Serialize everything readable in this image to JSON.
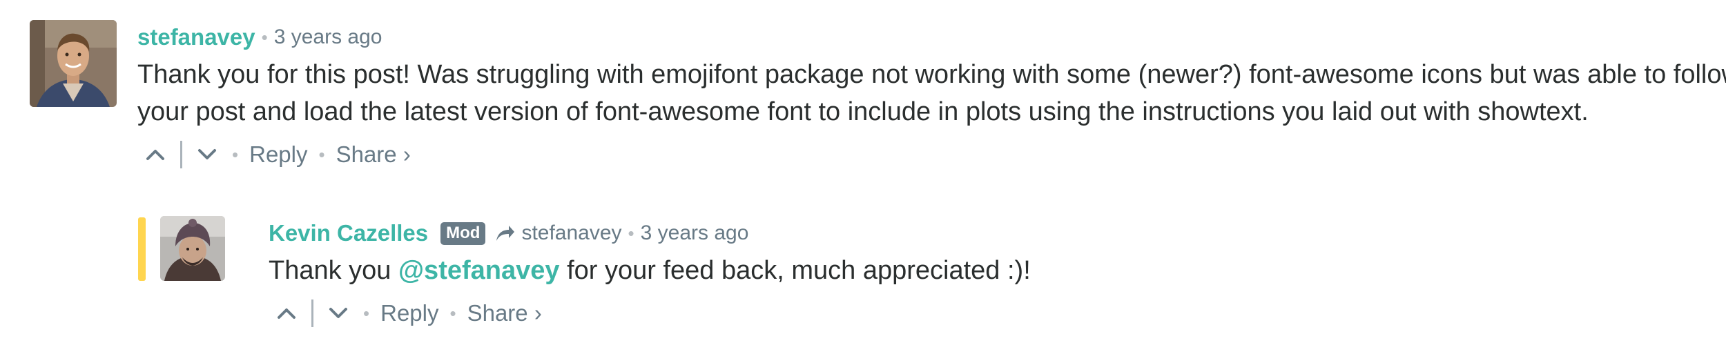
{
  "comments": [
    {
      "author": "stefanavey",
      "time": "3 years ago",
      "message": "Thank you for this post! Was struggling with emojifont package not working with some (newer?) font-awesome icons but was able to follow your post and load the latest version of font-awesome font to include in plots using the instructions you laid out with showtext.",
      "actions": {
        "reply": "Reply",
        "share": "Share ›"
      }
    },
    {
      "author": "Kevin Cazelles",
      "badge": "Mod",
      "in_reply_to": "stefanavey",
      "time": "3 years ago",
      "message_prefix": "Thank you ",
      "mention": "@stefanavey",
      "message_suffix": " for your feed back, much appreciated :)!",
      "actions": {
        "reply": "Reply",
        "share": "Share ›"
      }
    }
  ],
  "icons": {
    "upvote": "chevron-up-icon",
    "downvote": "chevron-down-icon",
    "reply_to": "share-arrow-icon"
  },
  "colors": {
    "accent": "#3db5a6",
    "muted": "#687a86",
    "text": "#2a2e2e",
    "reply_bar": "#ffd54f",
    "badge_bg": "#687a86"
  }
}
